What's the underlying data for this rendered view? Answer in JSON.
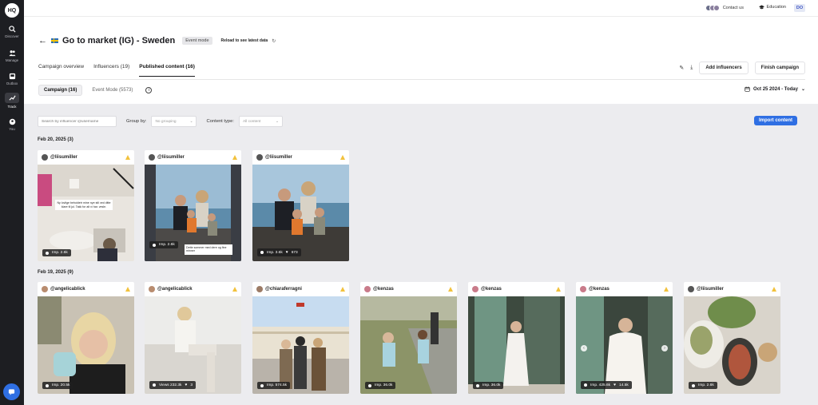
{
  "app": {
    "logo": "HQ"
  },
  "nav": [
    {
      "label": "Discover",
      "icon": "search-icon"
    },
    {
      "label": "Manage",
      "icon": "users-icon"
    },
    {
      "label": "Outbox",
      "icon": "inbox-icon"
    },
    {
      "label": "Track",
      "icon": "trend-icon",
      "active": true
    },
    {
      "label": "You",
      "icon": "person-icon"
    }
  ],
  "topbar": {
    "contact": "Contact us",
    "education": "Education",
    "user_initials": "DO"
  },
  "header": {
    "title": "Go to market (IG) - Sweden",
    "badge": "Event mode",
    "reload": "Reload to see latest data"
  },
  "tabs": [
    {
      "label": "Campaign overview"
    },
    {
      "label": "Influencers (19)"
    },
    {
      "label": "Published content (16)",
      "active": true
    }
  ],
  "actions": {
    "add_influencers": "Add influencers",
    "finish_campaign": "Finish campaign"
  },
  "segments": [
    {
      "label": "Campaign (16)",
      "active": true
    },
    {
      "label": "Event Mode (5573)"
    }
  ],
  "date_range": "Oct 25 2024 - Today",
  "filters": {
    "search_placeholder": "Search by influencer @username",
    "group_label": "Group by:",
    "group_value": "No grouping",
    "content_label": "Content type:",
    "content_value": "All content"
  },
  "import_label": "Import content",
  "groups": [
    {
      "date": "Feb 20, 2025 (3)",
      "posts": [
        {
          "handle": "@liisumiller",
          "imp": "Imp. 2.6k",
          "extra": "",
          "caption": "Ny lovlige beholdetr mine nye stil ved ditte klare til jul. Takk for alt vi har. vesle."
        },
        {
          "handle": "@liisumiller",
          "imp": "Imp. 2.6k",
          "extra": "",
          "caption2": "Dette sommer med dere og fine minner"
        },
        {
          "handle": "@liisumiller",
          "imp": "Imp. 3.6k",
          "extra": "673"
        }
      ]
    },
    {
      "date": "Feb 19, 2025 (9)",
      "posts": [
        {
          "handle": "@angelicablick",
          "imp": "Imp. 20.5k",
          "extra": ""
        },
        {
          "handle": "@angelicablick",
          "imp": "Views 232.3k",
          "extra": "3"
        },
        {
          "handle": "@chiaraferragni",
          "imp": "Imp. 574.5k",
          "extra": ""
        },
        {
          "handle": "@kenzas",
          "imp": "Imp. 36.0k",
          "extra": ""
        },
        {
          "handle": "@kenzas",
          "imp": "Imp. 36.0k",
          "extra": ""
        },
        {
          "handle": "@kenzas",
          "imp": "Imp. 425.6k",
          "extra": "14.5k"
        },
        {
          "handle": "@liisumiller",
          "imp": "Imp. 2.6k",
          "extra": ""
        }
      ]
    }
  ]
}
